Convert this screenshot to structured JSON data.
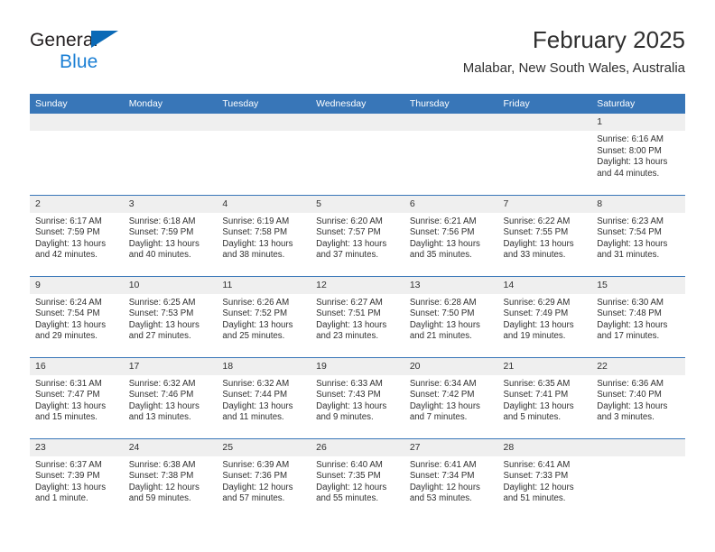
{
  "brand": {
    "name_top": "General",
    "name_bottom": "Blue",
    "triangle_color": "#0a69b6",
    "blue_text_color": "#1b7fd4"
  },
  "header": {
    "title": "February 2025",
    "subtitle": "Malabar, New South Wales, Australia"
  },
  "colors": {
    "header_row_background": "#3876b8",
    "day_band_background": "#efefef",
    "row_separator": "#3876b8",
    "text": "#303030"
  },
  "weekdays": [
    "Sunday",
    "Monday",
    "Tuesday",
    "Wednesday",
    "Thursday",
    "Friday",
    "Saturday"
  ],
  "weeks": [
    [
      {
        "day": "",
        "sunrise": "",
        "sunset": "",
        "daylight": ""
      },
      {
        "day": "",
        "sunrise": "",
        "sunset": "",
        "daylight": ""
      },
      {
        "day": "",
        "sunrise": "",
        "sunset": "",
        "daylight": ""
      },
      {
        "day": "",
        "sunrise": "",
        "sunset": "",
        "daylight": ""
      },
      {
        "day": "",
        "sunrise": "",
        "sunset": "",
        "daylight": ""
      },
      {
        "day": "",
        "sunrise": "",
        "sunset": "",
        "daylight": ""
      },
      {
        "day": "1",
        "sunrise": "Sunrise: 6:16 AM",
        "sunset": "Sunset: 8:00 PM",
        "daylight": "Daylight: 13 hours and 44 minutes."
      }
    ],
    [
      {
        "day": "2",
        "sunrise": "Sunrise: 6:17 AM",
        "sunset": "Sunset: 7:59 PM",
        "daylight": "Daylight: 13 hours and 42 minutes."
      },
      {
        "day": "3",
        "sunrise": "Sunrise: 6:18 AM",
        "sunset": "Sunset: 7:59 PM",
        "daylight": "Daylight: 13 hours and 40 minutes."
      },
      {
        "day": "4",
        "sunrise": "Sunrise: 6:19 AM",
        "sunset": "Sunset: 7:58 PM",
        "daylight": "Daylight: 13 hours and 38 minutes."
      },
      {
        "day": "5",
        "sunrise": "Sunrise: 6:20 AM",
        "sunset": "Sunset: 7:57 PM",
        "daylight": "Daylight: 13 hours and 37 minutes."
      },
      {
        "day": "6",
        "sunrise": "Sunrise: 6:21 AM",
        "sunset": "Sunset: 7:56 PM",
        "daylight": "Daylight: 13 hours and 35 minutes."
      },
      {
        "day": "7",
        "sunrise": "Sunrise: 6:22 AM",
        "sunset": "Sunset: 7:55 PM",
        "daylight": "Daylight: 13 hours and 33 minutes."
      },
      {
        "day": "8",
        "sunrise": "Sunrise: 6:23 AM",
        "sunset": "Sunset: 7:54 PM",
        "daylight": "Daylight: 13 hours and 31 minutes."
      }
    ],
    [
      {
        "day": "9",
        "sunrise": "Sunrise: 6:24 AM",
        "sunset": "Sunset: 7:54 PM",
        "daylight": "Daylight: 13 hours and 29 minutes."
      },
      {
        "day": "10",
        "sunrise": "Sunrise: 6:25 AM",
        "sunset": "Sunset: 7:53 PM",
        "daylight": "Daylight: 13 hours and 27 minutes."
      },
      {
        "day": "11",
        "sunrise": "Sunrise: 6:26 AM",
        "sunset": "Sunset: 7:52 PM",
        "daylight": "Daylight: 13 hours and 25 minutes."
      },
      {
        "day": "12",
        "sunrise": "Sunrise: 6:27 AM",
        "sunset": "Sunset: 7:51 PM",
        "daylight": "Daylight: 13 hours and 23 minutes."
      },
      {
        "day": "13",
        "sunrise": "Sunrise: 6:28 AM",
        "sunset": "Sunset: 7:50 PM",
        "daylight": "Daylight: 13 hours and 21 minutes."
      },
      {
        "day": "14",
        "sunrise": "Sunrise: 6:29 AM",
        "sunset": "Sunset: 7:49 PM",
        "daylight": "Daylight: 13 hours and 19 minutes."
      },
      {
        "day": "15",
        "sunrise": "Sunrise: 6:30 AM",
        "sunset": "Sunset: 7:48 PM",
        "daylight": "Daylight: 13 hours and 17 minutes."
      }
    ],
    [
      {
        "day": "16",
        "sunrise": "Sunrise: 6:31 AM",
        "sunset": "Sunset: 7:47 PM",
        "daylight": "Daylight: 13 hours and 15 minutes."
      },
      {
        "day": "17",
        "sunrise": "Sunrise: 6:32 AM",
        "sunset": "Sunset: 7:46 PM",
        "daylight": "Daylight: 13 hours and 13 minutes."
      },
      {
        "day": "18",
        "sunrise": "Sunrise: 6:32 AM",
        "sunset": "Sunset: 7:44 PM",
        "daylight": "Daylight: 13 hours and 11 minutes."
      },
      {
        "day": "19",
        "sunrise": "Sunrise: 6:33 AM",
        "sunset": "Sunset: 7:43 PM",
        "daylight": "Daylight: 13 hours and 9 minutes."
      },
      {
        "day": "20",
        "sunrise": "Sunrise: 6:34 AM",
        "sunset": "Sunset: 7:42 PM",
        "daylight": "Daylight: 13 hours and 7 minutes."
      },
      {
        "day": "21",
        "sunrise": "Sunrise: 6:35 AM",
        "sunset": "Sunset: 7:41 PM",
        "daylight": "Daylight: 13 hours and 5 minutes."
      },
      {
        "day": "22",
        "sunrise": "Sunrise: 6:36 AM",
        "sunset": "Sunset: 7:40 PM",
        "daylight": "Daylight: 13 hours and 3 minutes."
      }
    ],
    [
      {
        "day": "23",
        "sunrise": "Sunrise: 6:37 AM",
        "sunset": "Sunset: 7:39 PM",
        "daylight": "Daylight: 13 hours and 1 minute."
      },
      {
        "day": "24",
        "sunrise": "Sunrise: 6:38 AM",
        "sunset": "Sunset: 7:38 PM",
        "daylight": "Daylight: 12 hours and 59 minutes."
      },
      {
        "day": "25",
        "sunrise": "Sunrise: 6:39 AM",
        "sunset": "Sunset: 7:36 PM",
        "daylight": "Daylight: 12 hours and 57 minutes."
      },
      {
        "day": "26",
        "sunrise": "Sunrise: 6:40 AM",
        "sunset": "Sunset: 7:35 PM",
        "daylight": "Daylight: 12 hours and 55 minutes."
      },
      {
        "day": "27",
        "sunrise": "Sunrise: 6:41 AM",
        "sunset": "Sunset: 7:34 PM",
        "daylight": "Daylight: 12 hours and 53 minutes."
      },
      {
        "day": "28",
        "sunrise": "Sunrise: 6:41 AM",
        "sunset": "Sunset: 7:33 PM",
        "daylight": "Daylight: 12 hours and 51 minutes."
      },
      {
        "day": "",
        "sunrise": "",
        "sunset": "",
        "daylight": ""
      }
    ]
  ]
}
